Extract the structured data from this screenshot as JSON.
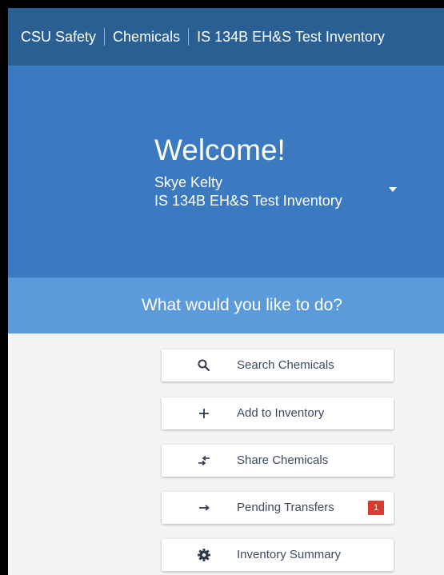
{
  "breadcrumb": {
    "items": [
      "CSU Safety",
      "Chemicals",
      "IS 134B EH&S Test Inventory"
    ]
  },
  "hero": {
    "welcome": "Welcome!",
    "user_name": "Skye Kelty",
    "inventory_name": "IS 134B EH&S Test Inventory",
    "dropdown_icon": "caret-down-icon"
  },
  "prompt": "What would you like to do?",
  "actions": [
    {
      "label": "Search Chemicals",
      "icon": "search-icon"
    },
    {
      "label": "Add to Inventory",
      "icon": "plus-icon"
    },
    {
      "label": "Share Chemicals",
      "icon": "transfer-icon"
    },
    {
      "label": "Pending Transfers",
      "icon": "arrow-right-icon",
      "badge": "1"
    },
    {
      "label": "Inventory Summary",
      "icon": "gear-icon"
    }
  ],
  "colors": {
    "topbar": "#2a5f94",
    "hero": "#3b79c0",
    "prompt_bar": "#5b9bdb",
    "badge": "#d73a2f"
  }
}
